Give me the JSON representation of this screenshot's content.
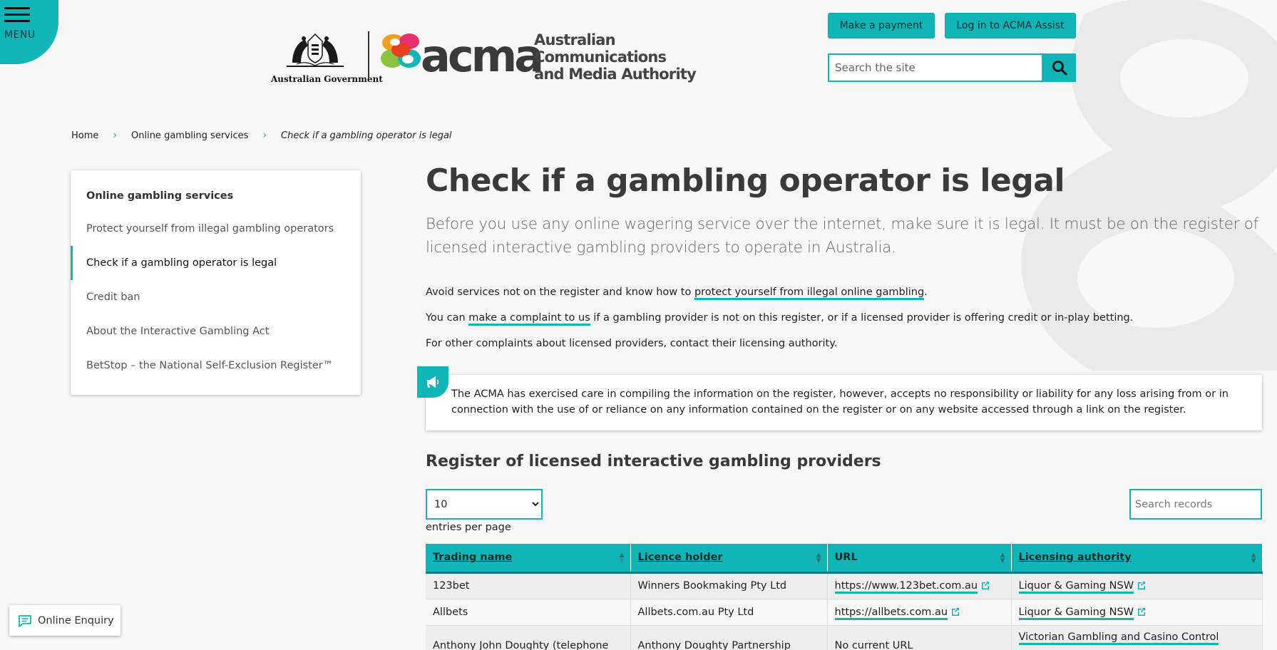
{
  "menu": {
    "label": "MENU"
  },
  "header": {
    "govt_label": "Australian Government",
    "acma_word": "acma",
    "acma_full": [
      "Australian",
      "Communications",
      "and Media Authority"
    ],
    "pay_button": "Make a payment",
    "login_button": "Log in to ACMA Assist",
    "search_placeholder": "Search the site"
  },
  "breadcrumb": {
    "home": "Home",
    "section": "Online gambling services",
    "current": "Check if a gambling operator is legal"
  },
  "sidebar": {
    "title": "Online gambling services",
    "items": [
      {
        "label": "Protect yourself from illegal gambling operators"
      },
      {
        "label": "Check if a gambling operator is legal"
      },
      {
        "label": "Credit ban"
      },
      {
        "label": "About the Interactive Gambling Act"
      },
      {
        "label": "BetStop – the National Self-Exclusion Register™"
      }
    ]
  },
  "main": {
    "title": "Check if a gambling operator is legal",
    "lead": "Before you use any online wagering service over the internet, make sure it is legal. It must be on the register of licensed interactive gambling providers to operate in Australia.",
    "p1_pre": "Avoid services not on the register and know how to ",
    "p1_link": "protect yourself from illegal online gambling",
    "p1_post": ".",
    "p2_pre": "You can ",
    "p2_link": "make a complaint to us",
    "p2_post": " if a gambling provider is not on this register, or if a licensed provider is offering credit or in-play betting.",
    "p3": "For other complaints about licensed providers, contact their licensing authority.",
    "notice": "The ACMA has exercised care in compiling the information on the register, however, accepts no responsibility or liability for any loss arising from or in connection with the use of or reliance on any information contained on the register or on any website accessed through a link on the register.",
    "register_title": "Register of licensed interactive gambling providers",
    "page_size": "10",
    "page_size_label": "entries per page",
    "search_records_placeholder": "Search records"
  },
  "table": {
    "headers": [
      "Trading name",
      "Licence holder",
      "URL",
      "Licensing authority"
    ],
    "rows": [
      {
        "trading": "123bet",
        "holder": "Winners Bookmaking Pty Ltd",
        "url": "https://www.123bet.com.au",
        "authority": "Liquor & Gaming NSW"
      },
      {
        "trading": "Allbets",
        "holder": "Allbets.com.au Pty Ltd",
        "url": "https://allbets.com.au",
        "authority": "Liquor & Gaming NSW"
      },
      {
        "trading": "Anthony John Doughty (telephone only)",
        "holder": "Anthony Doughty Partnership",
        "url": "No current URL",
        "authority": "Victorian Gambling and Casino Control"
      }
    ]
  },
  "enquiry": {
    "label": "Online Enquiry"
  },
  "colors": {
    "accent": "#10b5b8",
    "text": "#222222",
    "background": "#f7f7f7"
  }
}
